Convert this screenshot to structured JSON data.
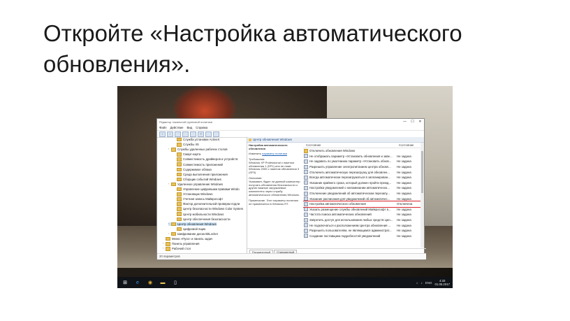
{
  "slide_title": "Откройте «Настройка автоматического обновления».",
  "window": {
    "title": "Редактор локальной групповой политики",
    "controls": [
      "—",
      "☐",
      "✕"
    ],
    "menu": [
      "Файл",
      "Действие",
      "Вид",
      "Справка"
    ]
  },
  "tree": [
    {
      "label": "Служба установки ActiveX",
      "indent": 2,
      "arrow": ""
    },
    {
      "label": "Службы IIS",
      "indent": 2,
      "arrow": ""
    },
    {
      "label": "Службы удаленных рабочих столов",
      "indent": 1,
      "arrow": "›"
    },
    {
      "label": "Смарт-карта",
      "indent": 2,
      "arrow": ""
    },
    {
      "label": "Совместимость драйверов и устройств",
      "indent": 2,
      "arrow": ""
    },
    {
      "label": "Совместимость приложений",
      "indent": 2,
      "arrow": ""
    },
    {
      "label": "Содержимое облака",
      "indent": 2,
      "arrow": ""
    },
    {
      "label": "Среда выполнения приложения",
      "indent": 2,
      "arrow": ""
    },
    {
      "label": "Сборщик событий Windows",
      "indent": 2,
      "arrow": ""
    },
    {
      "label": "Удаленное управление Windows",
      "indent": 1,
      "arrow": "›"
    },
    {
      "label": "Управление цифровыми правами Windo",
      "indent": 2,
      "arrow": ""
    },
    {
      "label": "Установщик Windows",
      "indent": 2,
      "arrow": ""
    },
    {
      "label": "Учетная запись Майкрософт",
      "indent": 2,
      "arrow": ""
    },
    {
      "label": "Фактор дополнительной проверки подли",
      "indent": 2,
      "arrow": ""
    },
    {
      "label": "Центр безопасности Windows Color System",
      "indent": 2,
      "arrow": ""
    },
    {
      "label": "Центр мобильности Windows",
      "indent": 2,
      "arrow": ""
    },
    {
      "label": "Центр обеспечения безопасности",
      "indent": 2,
      "arrow": ""
    },
    {
      "label": "Центр обновления Windows",
      "indent": 1,
      "arrow": "›",
      "selected": true
    },
    {
      "label": "Цифровой ящик",
      "indent": 2,
      "arrow": ""
    },
    {
      "label": "Шифрование диска BitLocker",
      "indent": 1,
      "arrow": "›"
    },
    {
      "label": "Меню «Пуск» и панель задач",
      "indent": 0,
      "arrow": ""
    },
    {
      "label": "Панель управления",
      "indent": 0,
      "arrow": "›"
    },
    {
      "label": "Рабочий стол",
      "indent": 0,
      "arrow": "›"
    }
  ],
  "right_header": "Центр обновления Windows",
  "description": {
    "title": "Настройка автоматического обновления",
    "edit_prefix": "Изменить",
    "edit_link": "параметр политики",
    "requirements_label": "Требования:",
    "requirements": "Windows XP Professional с пакетом обновления 1 (SP1) или не ниже Windows 2000 с пакетом обновления 3 (SP3)",
    "description_label": "Описание:",
    "description_text": "Указывает, будет ли данный компьютер получать обновления безопасности и другие важные загружаемые компоненты через службу автоматического обновления Windows.",
    "note": "Примечание. Этот параметр политики не применяется в Windows RT."
  },
  "list": {
    "col_state": "Состояние",
    "col_status": "Состояние",
    "rows": [
      {
        "name": "Отключить обновления Windows",
        "status": "",
        "folder": true
      },
      {
        "name": "Не отображать параметр «Установить обновления и заве...",
        "status": "Не задана"
      },
      {
        "name": "Не задавать по умолчанию параметр «Установить обнов...",
        "status": "Не задана"
      },
      {
        "name": "Разрешить управление электропитанием центра обновл...",
        "status": "Не задана"
      },
      {
        "name": "Отключить автоматическую перезагрузку для обновлен...",
        "status": "Не задана"
      },
      {
        "name": "Всегда автоматически перезагружаться в запланирован...",
        "status": "Не задана"
      },
      {
        "name": "Указание крайнего срока, который должен пройти прежд...",
        "status": "Не задана"
      },
      {
        "name": "Настройка уведомлений о напоминании автоматическо...",
        "status": "Не задана"
      },
      {
        "name": "Отключение уведомлений об автоматическом перезапу...",
        "status": "Не задана"
      },
      {
        "name": "Указание расписания для уведомлений об автоматичес...",
        "status": "Не задана"
      },
      {
        "name": "Настройка автоматического обновления",
        "status": "Отключена",
        "highlight": true
      },
      {
        "name": "Указать размещение службы обновлений Майкрософт в...",
        "status": "Не задана"
      },
      {
        "name": "Частота поиска автоматических обновлений",
        "status": "Не задана"
      },
      {
        "name": "Запретить доступ для использования любых средств Цен...",
        "status": "Не задана"
      },
      {
        "name": "Не подключаться к расположениям Центра обновления ...",
        "status": "Не задана"
      },
      {
        "name": "Разрешить пользователям, не являющимся администрат...",
        "status": "Не задана"
      },
      {
        "name": "Создание поставщика подробностей уведомлений",
        "status": "Не задана"
      }
    ]
  },
  "tabs": [
    "Расширенный",
    "Стандартный"
  ],
  "status_bar": "20 параметров",
  "taskbar": {
    "lang": "ENG",
    "time": "4:33",
    "date": "01.05.2017"
  },
  "colors": {
    "highlight": "#d9232b",
    "selection": "#cce4f7",
    "folder": "#e9c15a"
  }
}
